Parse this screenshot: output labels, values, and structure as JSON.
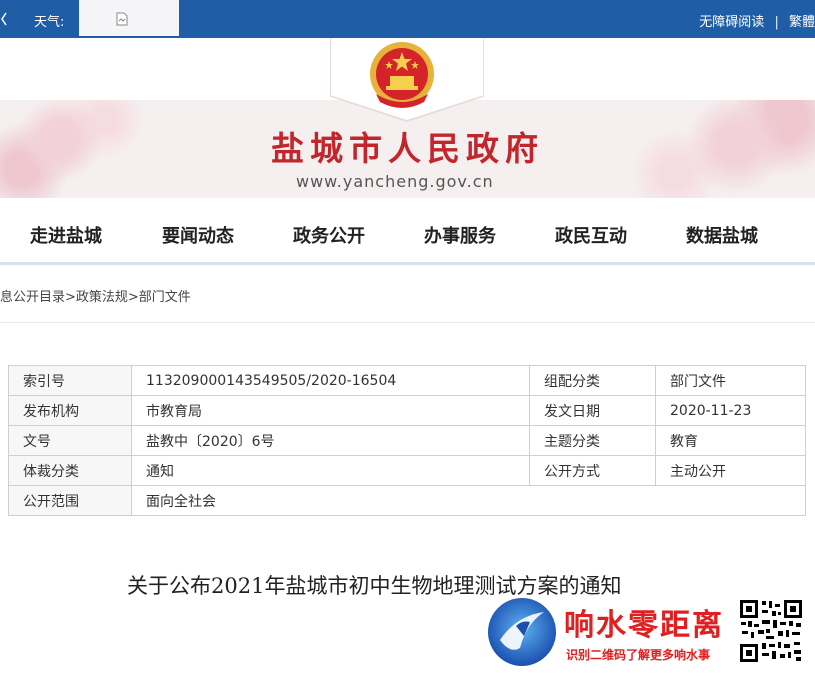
{
  "topbar": {
    "weather_label": "天气:",
    "accessible_reading": "无障碍阅读",
    "separator": "|",
    "traditional": "繁體"
  },
  "header": {
    "title": "盐城市人民政府",
    "url": "www.yancheng.gov.cn"
  },
  "nav": {
    "items": [
      "走进盐城",
      "要闻动态",
      "政务公开",
      "办事服务",
      "政民互动",
      "数据盐城"
    ]
  },
  "breadcrumb": {
    "path": "息公开目录>政策法规>部门文件"
  },
  "meta": {
    "rows": [
      {
        "k1": "索引号",
        "v1": "113209000143549505/2020-16504",
        "k2": "组配分类",
        "v2": "部门文件"
      },
      {
        "k1": "发布机构",
        "v1": "市教育局",
        "k2": "发文日期",
        "v2": "2020-11-23"
      },
      {
        "k1": "文号",
        "v1": "盐教中〔2020〕6号",
        "k2": "主题分类",
        "v2": "教育"
      },
      {
        "k1": "体裁分类",
        "v1": "通知",
        "k2": "公开方式",
        "v2": "主动公开"
      },
      {
        "k1": "公开范围",
        "v1": "面向全社会"
      }
    ]
  },
  "article": {
    "title": "关于公布2021年盐城市初中生物地理测试方案的通知"
  },
  "watermark": {
    "name": "响水零距离",
    "subtitle": "识别二维码了解更多响水事"
  },
  "icons": {
    "weather": "broken-image-icon",
    "emblem": "national-emblem-icon",
    "watermark_logo": "xiangshui-logo-icon",
    "qr": "qr-code-icon"
  },
  "colors": {
    "topbar": "#1f5ea6",
    "title_red": "#c0262b",
    "watermark_red": "#e02020"
  }
}
